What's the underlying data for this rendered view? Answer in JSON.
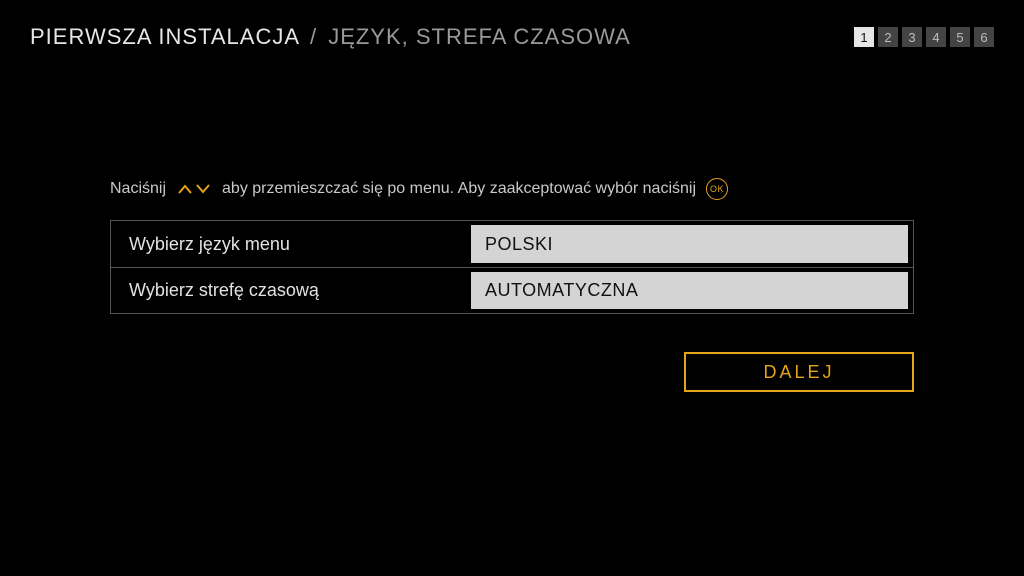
{
  "header": {
    "title_main": "PIERWSZA INSTALACJA",
    "separator": "/",
    "title_sub": "JĘZYK, STREFA CZASOWA"
  },
  "steps": {
    "items": [
      "1",
      "2",
      "3",
      "4",
      "5",
      "6"
    ],
    "active_index": 0
  },
  "hint": {
    "part1": "Naciśnij",
    "part2": "aby przemieszczać się po menu. Aby zaakceptować wybór naciśnij",
    "ok_label": "OK"
  },
  "rows": {
    "language": {
      "label": "Wybierz język menu",
      "value": "POLSKI"
    },
    "timezone": {
      "label": "Wybierz strefę czasową",
      "value": "AUTOMATYCZNA"
    }
  },
  "buttons": {
    "next": "DALEJ"
  }
}
